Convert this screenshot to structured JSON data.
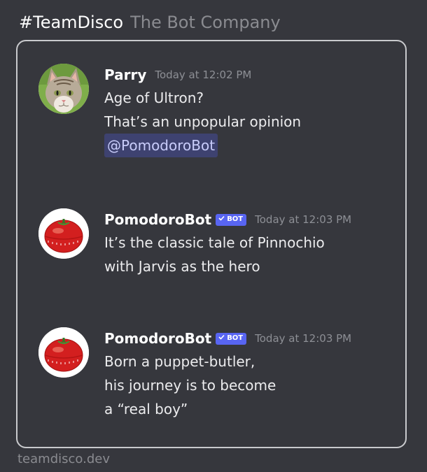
{
  "header": {
    "tag": "#TeamDisco",
    "subtitle": "The Bot Company"
  },
  "messages": [
    {
      "author": "Parry",
      "is_bot": false,
      "avatar": "cat-avatar-icon",
      "timestamp": "Today at 12:02 PM",
      "lines": [
        "Age of Ultron?",
        "That’s an unpopular opinion"
      ],
      "mention": "@PomodoroBot"
    },
    {
      "author": "PomodoroBot",
      "is_bot": true,
      "badge": "BOT",
      "avatar": "tomato-timer-avatar-icon",
      "timestamp": "Today at 12:03 PM",
      "lines": [
        "It’s the classic tale of Pinnochio",
        "with Jarvis as the hero"
      ]
    },
    {
      "author": "PomodoroBot",
      "is_bot": true,
      "badge": "BOT",
      "avatar": "tomato-timer-avatar-icon",
      "timestamp": "Today at 12:03 PM",
      "lines": [
        "Born a puppet-butler,",
        "his journey is to become",
        "a “real boy”"
      ]
    }
  ],
  "footer": {
    "text": "teamdisco.dev"
  },
  "colors": {
    "background": "#36373d",
    "mention_bg": "#3e4270",
    "mention_text": "#c9cdfb",
    "badge": "#5865f2",
    "muted": "#8a8b90"
  }
}
